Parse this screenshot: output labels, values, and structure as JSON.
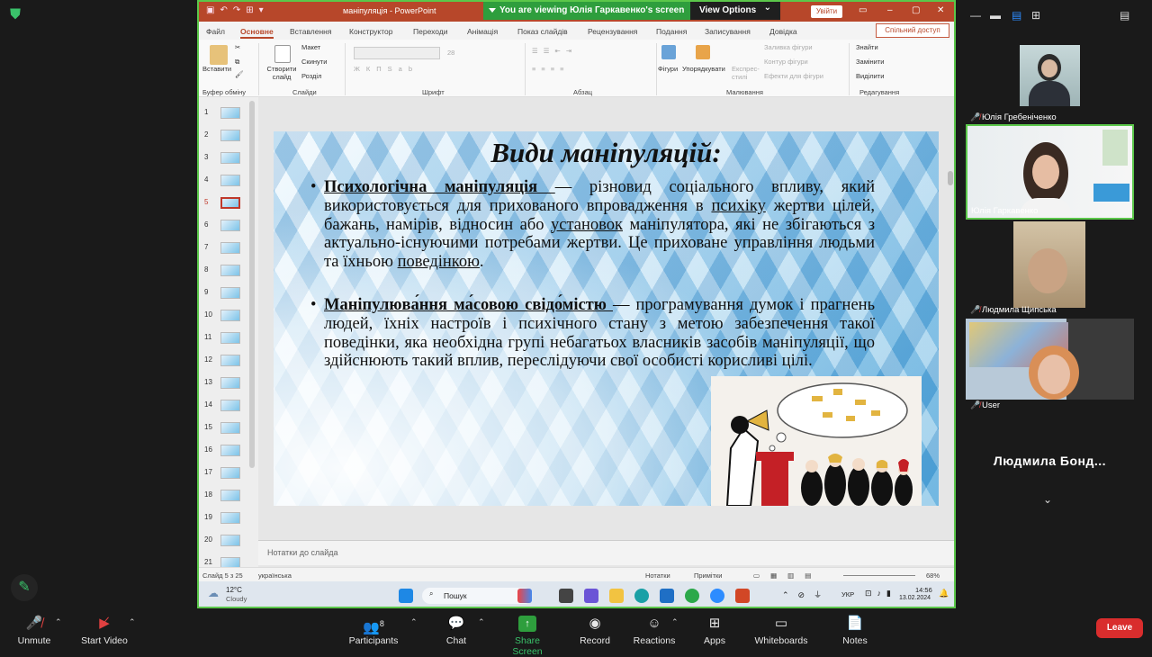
{
  "pp": {
    "doc_title": "маніпуляція - PowerPoint",
    "banner": "You are viewing Юлія Гаркавенко's screen",
    "view_options": "View Options",
    "sign_in": "Увійти",
    "tabs": [
      "Файл",
      "Основне",
      "Вставлення",
      "Конструктор",
      "Переходи",
      "Анімація",
      "Показ слайдів",
      "Рецензування",
      "Подання",
      "Записування",
      "Довідка"
    ],
    "share": "Спільний доступ",
    "ribbon": {
      "paste": "Вставити",
      "new_slide": "Створити слайд",
      "layout": "Макет",
      "reset": "Скинути",
      "section": "Розділ",
      "shapes": "Фігури",
      "arrange": "Упорядкувати",
      "quick_styles": "Експрес-стилі",
      "shape_fill": "Заливка фігури",
      "shape_outline": "Контур фігури",
      "shape_effects": "Ефекти для фігури",
      "find": "Знайти",
      "replace": "Замінити",
      "select": "Виділити",
      "font_size": "28",
      "groups": [
        "Буфер обміну",
        "Слайди",
        "Шрифт",
        "Абзац",
        "Малювання",
        "Редагування"
      ]
    },
    "thumb_numbers": [
      "1",
      "2",
      "3",
      "4",
      "5",
      "6",
      "7",
      "8",
      "9",
      "10",
      "11",
      "12",
      "13",
      "14",
      "15",
      "16",
      "17",
      "18",
      "19",
      "20",
      "21"
    ],
    "notes_placeholder": "Нотатки до слайда",
    "status": {
      "slide": "Слайд 5 з 25",
      "lang": "українська",
      "notes": "Нотатки",
      "comments": "Примітки",
      "zoom": "68%"
    },
    "taskbar": {
      "temp": "12°C",
      "weather": "Cloudy",
      "search": "Пошук",
      "lang": "УКР",
      "time": "14:56",
      "date": "13.02.2024"
    }
  },
  "slide": {
    "title": "Види маніпуляцій:",
    "bullets": [
      {
        "term": "Психологічна маніпуляція ",
        "text_a": "— різновид соціального впливу, який використовується для прихованого впровадження в ",
        "link1": "психіку",
        "text_b": " жертви цілей, бажань, намірів, відносин або ",
        "link2": "установок",
        "text_c": " маніпулятора, які не збігаються з актуально-існуючими потребами жертви. Це приховане управління людьми та їхньою ",
        "link3": "поведінкою",
        "text_d": "."
      },
      {
        "term": "Маніпулюва́ння ма́совою свідо́містю ",
        "text": "— програмування думок і прагнень людей, їхніх настроїв і психічного стану з метою забезпечення такої поведінки, яка необхідна групі небагатьох власників засобів маніпуляції, що здійснюють такий вплив, переслідуючи свої особисті корисливі цілі."
      }
    ]
  },
  "participants_panel": [
    {
      "name": "Юлія Гребеніченко"
    },
    {
      "name": "Юлія Гаркавенко"
    },
    {
      "name": "Людмила Щипська"
    },
    {
      "name": "User"
    }
  ],
  "bottom_tile": {
    "name": "Людмила Бонд..."
  },
  "toolbar": {
    "unmute": "Unmute",
    "start_video": "Start Video",
    "participants": "Participants",
    "participants_count": "8",
    "chat": "Chat",
    "share_screen": "Share Screen",
    "record": "Record",
    "reactions": "Reactions",
    "apps": "Apps",
    "whiteboards": "Whiteboards",
    "notes": "Notes",
    "leave": "Leave"
  }
}
